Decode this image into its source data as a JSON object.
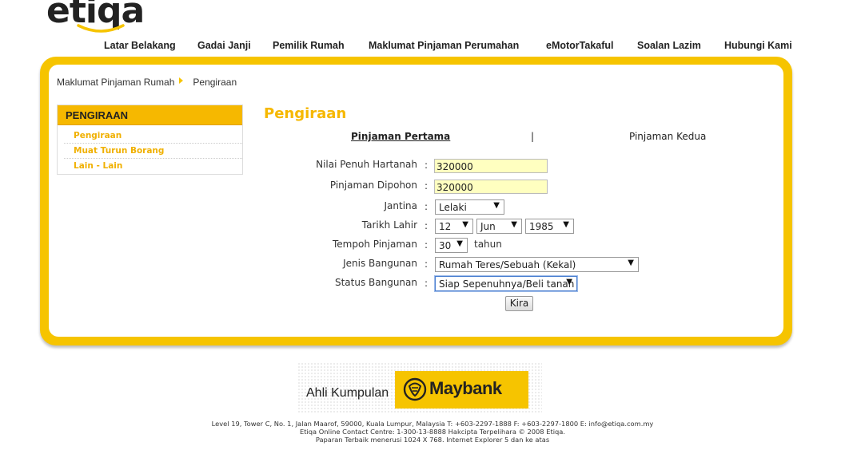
{
  "brand": {
    "logo_text": "etiqa",
    "accent": "#f6c400"
  },
  "nav": {
    "items": [
      "Latar Belakang",
      "Gadai Janji",
      "Pemilik Rumah",
      "Maklumat Pinjaman Perumahan",
      "eMotorTakaful",
      "Soalan Lazim",
      "Hubungi Kami"
    ]
  },
  "breadcrumb": {
    "parent": "Maklumat Pinjaman Rumah",
    "current": "Pengiraan"
  },
  "sidebar": {
    "title": "PENGIRAAN",
    "items": [
      "Pengiraan",
      "Muat Turun Borang",
      "Lain - Lain"
    ]
  },
  "main": {
    "title": "Pengiraan",
    "tabs": [
      "Pinjaman Pertama",
      "Pinjaman Kedua"
    ],
    "tab_separator": "|",
    "form": {
      "colon": ":",
      "nilai_label": "Nilai Penuh Hartanah",
      "nilai_value": "320000",
      "pinjaman_label": "Pinjaman Dipohon",
      "pinjaman_value": "320000",
      "jantina_label": "Jantina",
      "jantina_value": "Lelaki",
      "tarikh_label": "Tarikh Lahir",
      "tarikh_day": "12",
      "tarikh_month": "Jun",
      "tarikh_year": "1985",
      "tempoh_label": "Tempoh Pinjaman",
      "tempoh_value": "30",
      "tempoh_unit": "tahun",
      "jenis_label": "Jenis Bangunan",
      "jenis_value": "Rumah Teres/Sebuah (Kekal)",
      "status_label": "Status Bangunan",
      "status_value": "Siap Sepenuhnya/Beli tanah",
      "submit_label": "Kira"
    }
  },
  "partner": {
    "prefix": "Ahli Kumpulan",
    "name": "Maybank"
  },
  "footer": {
    "line1": "Level 19, Tower C, No. 1, Jalan Maarof, 59000, Kuala Lumpur, Malaysia T: +603-2297-1888 F: +603-2297-1800 E: info@etiqa.com.my",
    "line2": "Etiqa Online Contact Centre: 1-300-13-8888 Hakcipta Terpelihara © 2008 Etiqa.",
    "line3": "Paparan Terbaik menerusi 1024 X 768. Internet Explorer 5 dan ke atas"
  }
}
